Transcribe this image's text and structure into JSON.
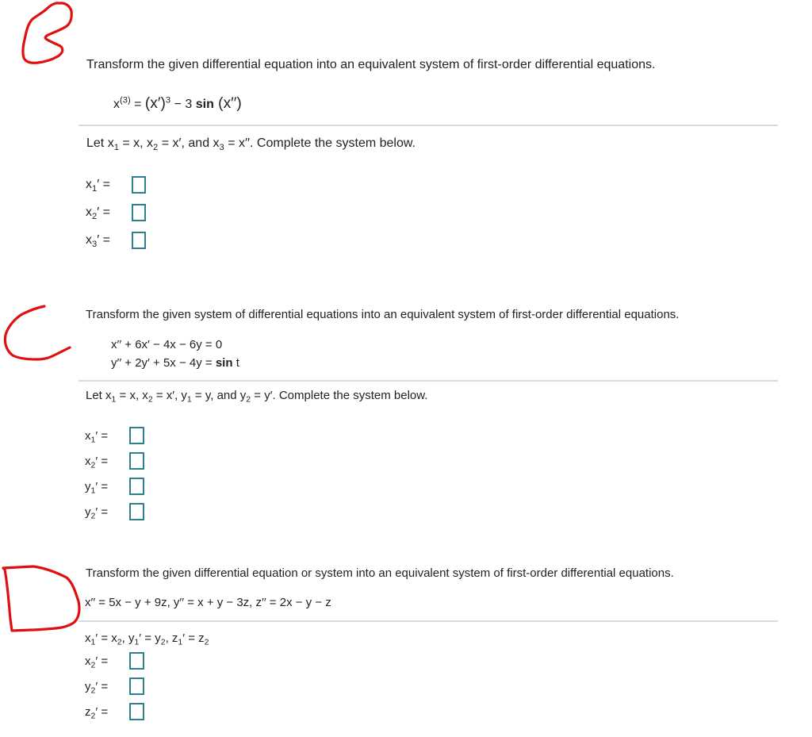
{
  "annotations": {
    "section_b_mark": "B",
    "section_c_mark": "C",
    "section_d_mark": "D",
    "color": "#e01010"
  },
  "colors": {
    "answer_box_border": "#2e7f8f",
    "divider": "#d6dbe0",
    "text": "#222222"
  },
  "problems": [
    {
      "label": "B",
      "prompt": "Transform the given differential equation into an equivalent system of first-order differential equations.",
      "equation": {
        "lhs_base": "x",
        "lhs_sup": "(3)",
        "eq": " = ",
        "t1": "(x′)",
        "t1_sup": "3",
        "t2": " − 3 ",
        "fn": "sin",
        "t3": " (x′′)"
      },
      "let_text": {
        "p1": "Let x",
        "s1": "1",
        "p2": " = x, x",
        "s2": "2",
        "p3": " = x′, and x",
        "s3": "3",
        "p4": " = x′′. Complete the system below."
      },
      "rows": [
        {
          "var": "x",
          "sub": "1",
          "suffix": "′ =",
          "value": ""
        },
        {
          "var": "x",
          "sub": "2",
          "suffix": "′ =",
          "value": ""
        },
        {
          "var": "x",
          "sub": "3",
          "suffix": "′ =",
          "value": ""
        }
      ]
    },
    {
      "label": "C",
      "prompt": "Transform the given system of differential equations into an equivalent system of first-order differential equations.",
      "equation_line1": "x′′ + 6x′ − 4x − 6y = 0",
      "equation_line2_pre": "y′′ + 2y′ + 5x − 4y = ",
      "equation_line2_fn": "sin",
      "equation_line2_post": " t",
      "let_text": {
        "p1": "Let x",
        "s1": "1",
        "p2": " = x, x",
        "s2": "2",
        "p3": " = x′, y",
        "s3": "1",
        "p4": " = y, and y",
        "s4": "2",
        "p5": " = y′. Complete the system below."
      },
      "rows": [
        {
          "var": "x",
          "sub": "1",
          "suffix": "′ =",
          "value": ""
        },
        {
          "var": "x",
          "sub": "2",
          "suffix": "′ =",
          "value": ""
        },
        {
          "var": "y",
          "sub": "1",
          "suffix": "′ =",
          "value": ""
        },
        {
          "var": "y",
          "sub": "2",
          "suffix": "′ =",
          "value": ""
        }
      ]
    },
    {
      "label": "D",
      "prompt": "Transform the given differential equation or system into an equivalent system of first-order differential equations.",
      "equation": "x′′ = 5x − y + 9z, y′′ = x + y − 3z, z′′ = 2x − y − z",
      "given": {
        "a": "x",
        "a_sub": "1",
        "a_eq": "′ = x",
        "a_rhs_sub": "2",
        "b": ", y",
        "b_sub": "1",
        "b_eq": "′ = y",
        "b_rhs_sub": "2",
        "c": ", z",
        "c_sub": "1",
        "c_eq": "′ =  z",
        "c_rhs_sub": "2"
      },
      "rows": [
        {
          "var": "x",
          "sub": "2",
          "suffix": "′ =",
          "value": ""
        },
        {
          "var": "y",
          "sub": "2",
          "suffix": "′ =",
          "value": ""
        },
        {
          "var": "z",
          "sub": "2",
          "suffix": "′ =",
          "value": ""
        }
      ]
    }
  ]
}
